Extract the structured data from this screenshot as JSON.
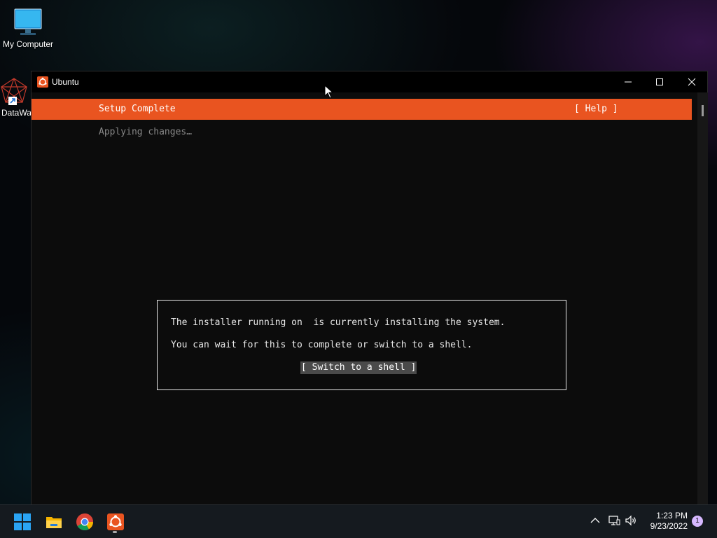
{
  "desktop": {
    "icons": [
      {
        "label": "My Computer",
        "icon": "monitor-icon"
      },
      {
        "label": "DataWa",
        "icon": "app-shortcut-icon"
      }
    ]
  },
  "window": {
    "title": "Ubuntu",
    "controls": [
      "minimize-icon",
      "maximize-icon",
      "close-icon"
    ]
  },
  "installer": {
    "header_title": "Setup Complete",
    "help_label": "[ Help ]",
    "status": "Applying changes…",
    "dialog": {
      "line1": "The installer running on  is currently installing the system.",
      "line2": "You can wait for this to complete or switch to a shell.",
      "button": "[ Switch to a shell ]"
    },
    "accent_color": "#e95420"
  },
  "taskbar": {
    "apps": [
      "windows-start-icon",
      "file-explorer-icon",
      "chrome-icon",
      "ubuntu-icon"
    ],
    "tray": [
      "chevron-up-icon",
      "network-icon",
      "volume-icon"
    ],
    "time": "1:23 PM",
    "date": "9/23/2022",
    "notification_count": "1"
  }
}
